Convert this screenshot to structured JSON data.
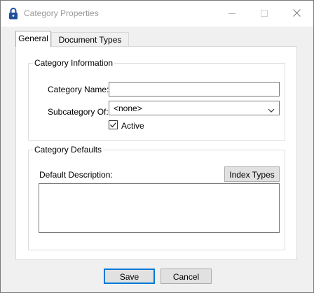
{
  "window": {
    "title": "Category Properties",
    "icon": "lock-icon",
    "controls": [
      "minimize-icon",
      "maximize-icon",
      "close-icon"
    ]
  },
  "tabs": [
    {
      "label": "General",
      "selected": true
    },
    {
      "label": "Document Types",
      "selected": false
    }
  ],
  "category_information": {
    "legend": "Category Information",
    "name_label": "Category Name:",
    "name_value": "",
    "subcategory_label": "Subcategory Of:",
    "subcategory_value": "<none>",
    "active_label": "Active",
    "active_checked": true
  },
  "category_defaults": {
    "legend": "Category Defaults",
    "description_label": "Default Description:",
    "index_types_button": "Index Types",
    "description_value": ""
  },
  "footer": {
    "save_label": "Save",
    "cancel_label": "Cancel"
  },
  "colors": {
    "accent": "#0078d7",
    "title_text": "#999999"
  }
}
